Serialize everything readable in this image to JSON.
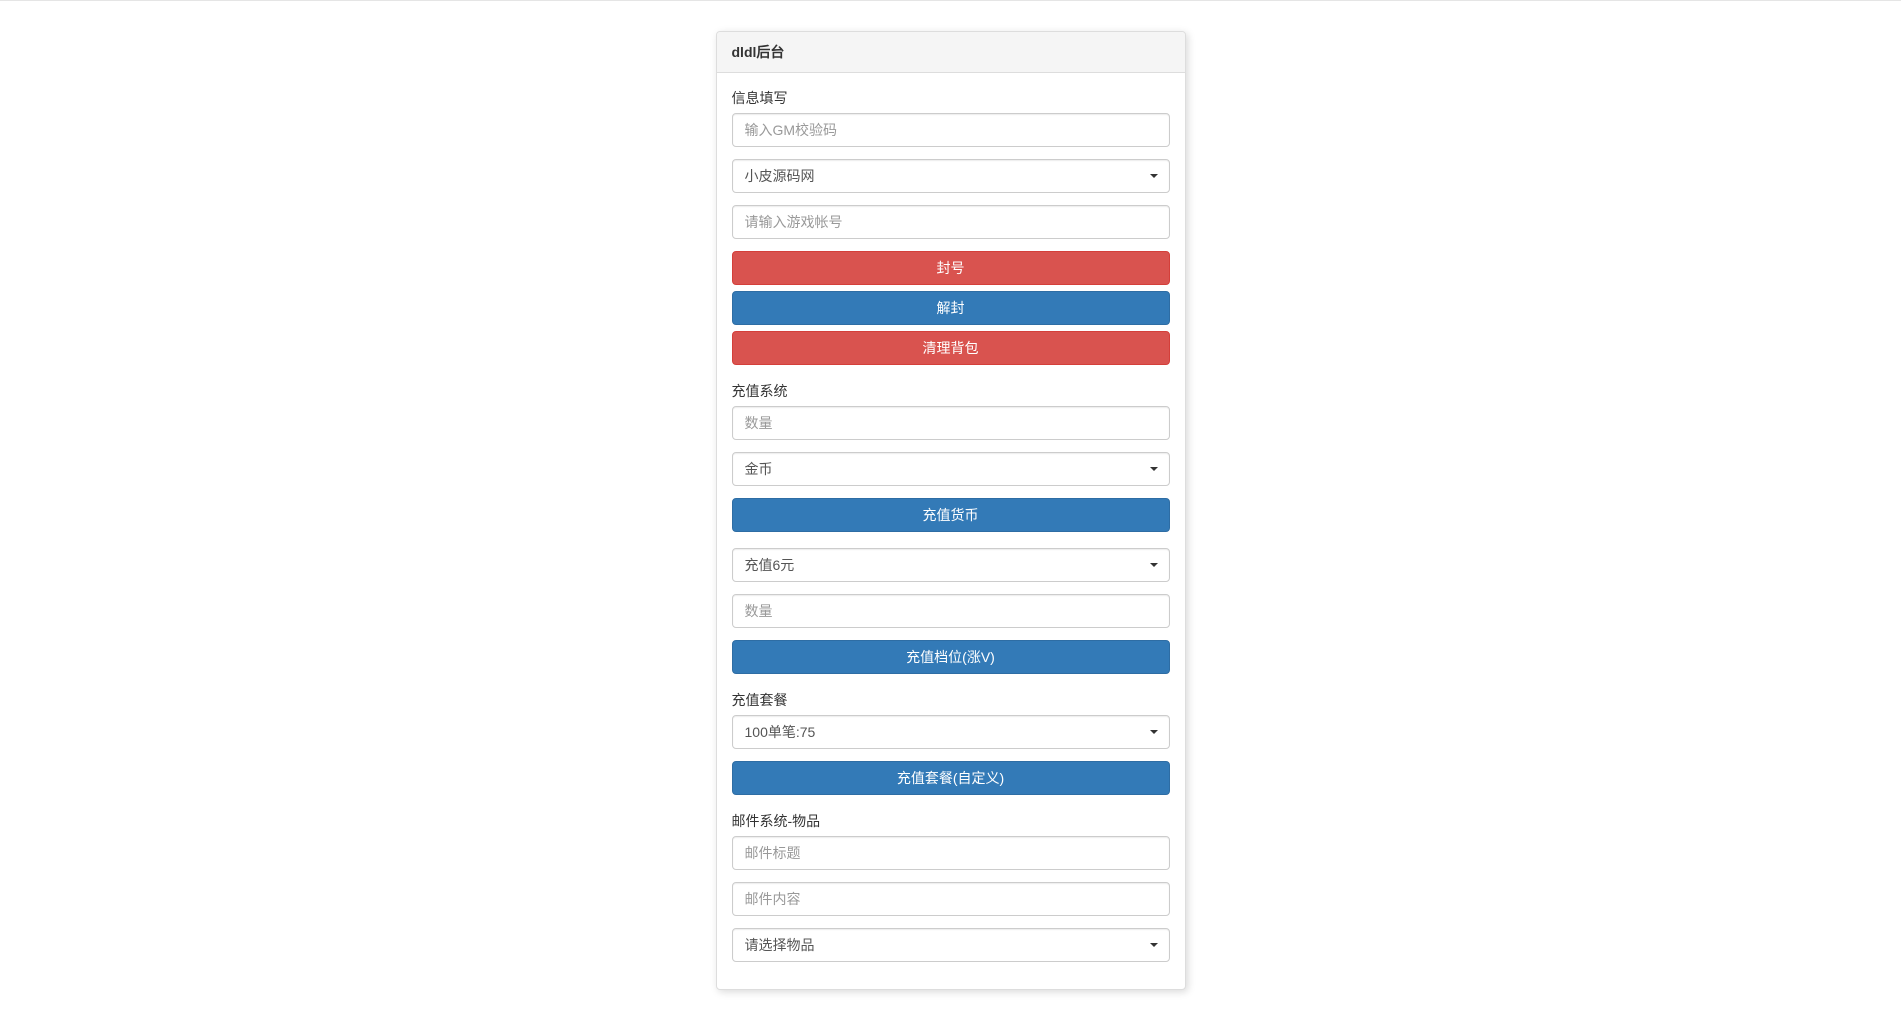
{
  "panel": {
    "title": "dldl后台"
  },
  "info": {
    "label": "信息填写",
    "gm_code_placeholder": "输入GM校验码",
    "server_selected": "小皮源码网",
    "account_placeholder": "请输入游戏帐号",
    "ban_button": "封号",
    "unban_button": "解封",
    "clear_bag_button": "清理背包"
  },
  "recharge": {
    "label": "充值系统",
    "quantity_placeholder": "数量",
    "currency_selected": "金币",
    "recharge_currency_button": "充值货币",
    "tier_selected": "充值6元",
    "tier_quantity_placeholder": "数量",
    "recharge_tier_button": "充值档位(涨V)"
  },
  "package": {
    "label": "充值套餐",
    "package_selected": "100单笔:75",
    "recharge_package_button": "充值套餐(自定义)"
  },
  "mail": {
    "label": "邮件系统-物品",
    "title_placeholder": "邮件标题",
    "content_placeholder": "邮件内容",
    "item_selected": "请选择物品"
  }
}
